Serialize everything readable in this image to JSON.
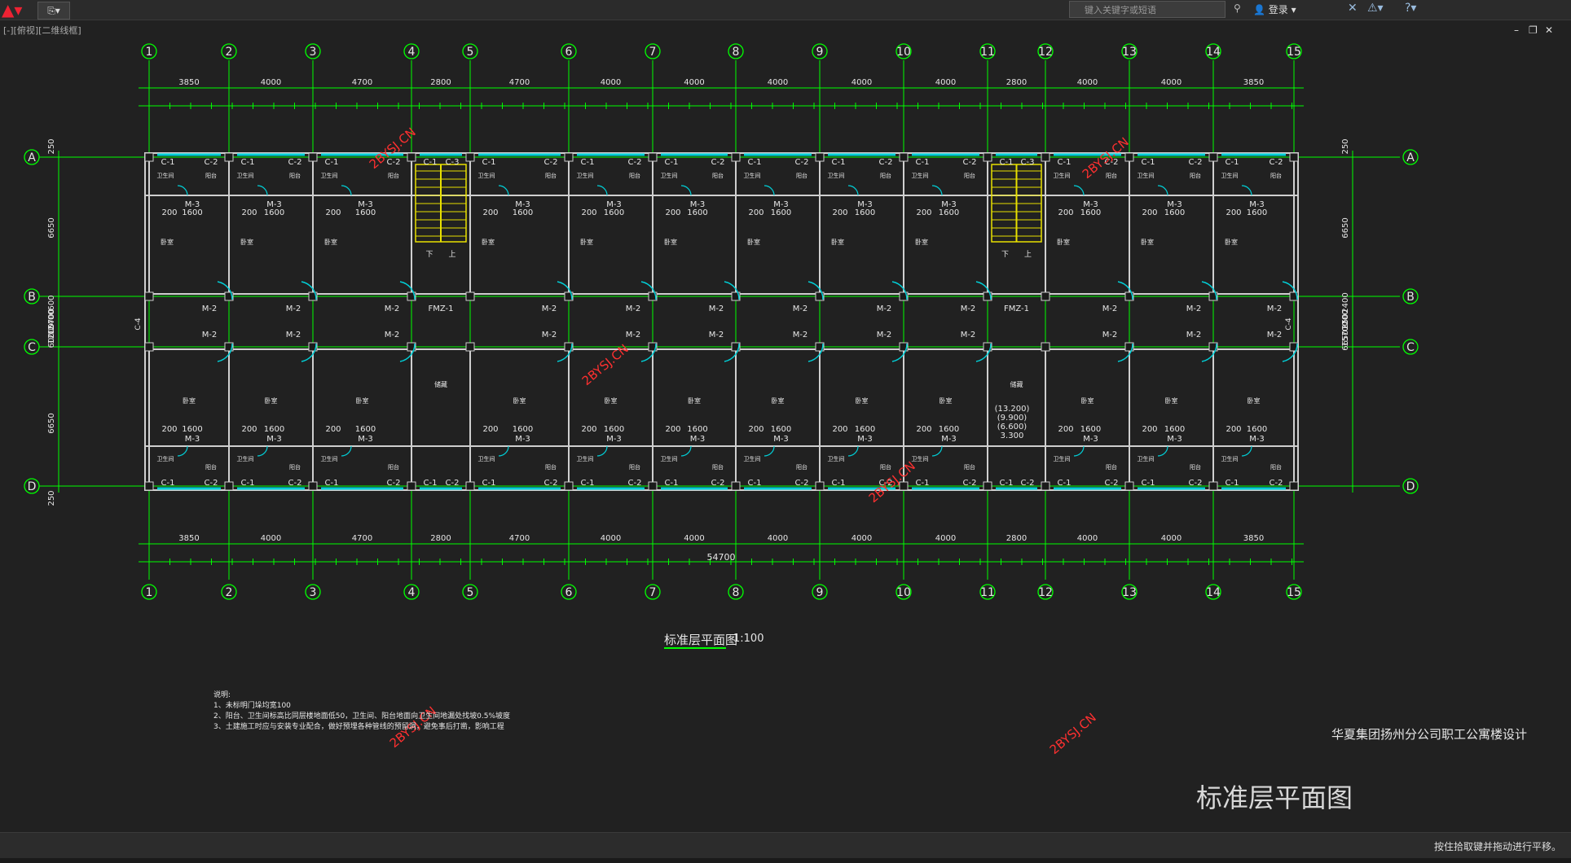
{
  "toolbar": {
    "quick_access": "⎘▾",
    "search_placeholder": "键入关键字或短语",
    "login_label": "登录"
  },
  "view_label": "[-][俯视][二维线框]",
  "drawing": {
    "grid_cols": [
      "1",
      "2",
      "3",
      "4",
      "5",
      "6",
      "7",
      "8",
      "9",
      "10",
      "11",
      "12",
      "13",
      "14",
      "15"
    ],
    "grid_rows": [
      "A",
      "B",
      "C",
      "D"
    ],
    "top_dims": [
      "3850",
      "4000",
      "4700",
      "2800",
      "4700",
      "4000",
      "4000",
      "4000",
      "4000",
      "4000",
      "2800",
      "4000",
      "4000",
      "3850"
    ],
    "bottom_dims": [
      "3850",
      "4000",
      "4700",
      "2800",
      "4700",
      "4000",
      "4000",
      "4000",
      "4000",
      "4000",
      "2800",
      "4000",
      "4000",
      "3850"
    ],
    "total_dim": "54700",
    "left_dims": [
      "250",
      "6650",
      "600",
      "2400",
      "1200",
      "600",
      "15700",
      "6650",
      "250"
    ],
    "right_dims": [
      "250",
      "6650",
      "2400",
      "1200",
      "15700",
      "6650",
      "250"
    ],
    "room_bedroom": "卧室",
    "room_bath": "卫生间",
    "room_balcony": "阳台",
    "room_storage": "储藏",
    "window_c1": "C-1",
    "window_c2": "C-2",
    "window_c3": "C-3",
    "window_c4": "C-4",
    "door_m2": "M-2",
    "door_m3": "M-3",
    "door_fm": "FMZ-1",
    "dim_1600": "1600",
    "dim_200": "200",
    "elev_1": "(13.200)",
    "elev_2": "(9.900)",
    "elev_3": "(6.600)",
    "elev_4": "3.300",
    "stair_down": "下",
    "stair_up": "上",
    "plan_title": "标准层平面图",
    "plan_scale": "1:100",
    "notes_title": "说明:",
    "note_1": "1、未标明门垛均宽100",
    "note_2": "2、阳台、卫生间标高比同层楼地面低50，卫生间、阳台地面向卫生间地漏处找坡0.5%坡度",
    "note_3": "3、土建施工时应与安装专业配合，做好预埋各种管线的预留洞，避免事后打凿，影响工程",
    "project_title": "华夏集团扬州分公司职工公寓楼设计",
    "drawing_name": "标准层平面图",
    "watermark": "2BYSJ.CN"
  },
  "status": {
    "message": "按住拾取键并拖动进行平移。"
  },
  "colors": {
    "background": "#212121",
    "grid_green": "#00ff00",
    "wall": "#cfcfcf",
    "door_cyan": "#00d0d8",
    "stair_yellow": "#e8e000",
    "watermark": "#ff3030"
  }
}
